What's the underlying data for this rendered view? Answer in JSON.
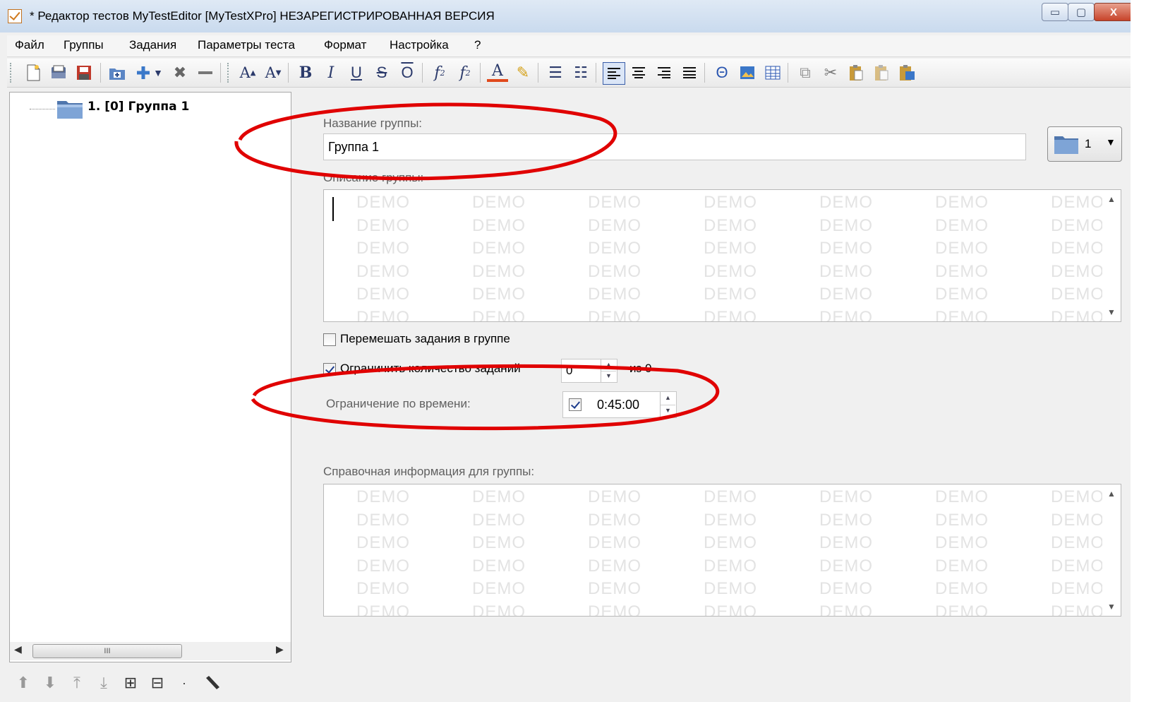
{
  "window": {
    "title": "* Редактор тестов MyTestEditor [MyTestXPro] НЕЗАРЕГИСТРИРОВАННАЯ ВЕРСИЯ",
    "controls": {
      "minimize": "▭",
      "maximize": "▢",
      "close": "X"
    }
  },
  "menu": {
    "items": [
      "Файл",
      "Группы",
      "Задания",
      "Параметры теста",
      "Формат",
      "Настройка",
      "?"
    ]
  },
  "toolbar": {
    "icons": [
      "new-file-icon",
      "open-file-icon",
      "save-file-icon",
      "add-group-icon",
      "add-task-icon",
      "dropdown-arrow-icon",
      "delete-icon",
      "remove-icon",
      "font-grow-icon",
      "font-shrink-icon",
      "bold-icon",
      "italic-icon",
      "underline-icon",
      "strikethrough-icon",
      "overline-icon",
      "subscript-icon",
      "superscript-icon",
      "font-color-icon",
      "highlight-icon",
      "bullet-list-icon",
      "numbered-list-icon",
      "align-left-icon",
      "align-center-icon",
      "align-right-icon",
      "align-justify-icon",
      "symbol-icon",
      "image-icon",
      "table-icon",
      "copy-icon",
      "cut-icon",
      "paste-icon",
      "paste-special-icon",
      "paste-format-icon"
    ]
  },
  "tree": {
    "items": [
      {
        "label": "1. [0] Группа 1"
      }
    ],
    "scroll_thumb_label": "III"
  },
  "group": {
    "name_label": "Название группы:",
    "name_value": "Группа 1",
    "icon_number": "1",
    "description_label": "Описание группы:",
    "watermark": "DEMO",
    "shuffle_label": "Перемешать задания в группе",
    "shuffle_checked": false,
    "limit_count_label": "Ограничить количество заданий",
    "limit_count_checked": true,
    "limit_count_value": "0",
    "limit_count_of": "из 0",
    "time_limit_label": "Ограничение по времени:",
    "time_limit_checked": true,
    "time_limit_value": "0:45:00",
    "help_label": "Справочная информация для группы:"
  },
  "colors": {
    "annotation": "#e00000",
    "watermark": "#e3e3e3",
    "label_grey": "#606060"
  }
}
